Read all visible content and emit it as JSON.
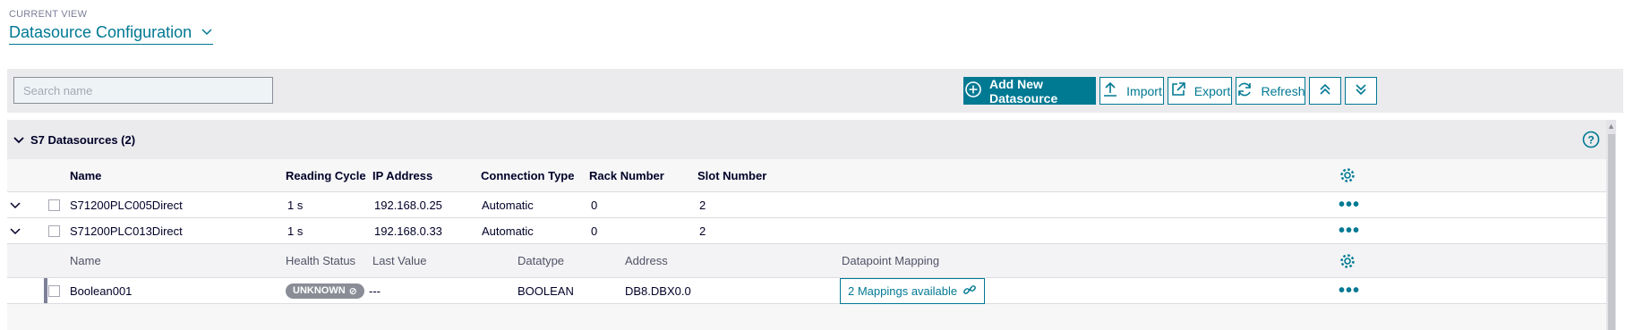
{
  "view": {
    "caption": "CURRENT VIEW",
    "title": "Datasource Configuration"
  },
  "toolbar": {
    "search_placeholder": "Search name",
    "add_label": "Add New Datasource",
    "import_label": "Import",
    "export_label": "Export",
    "refresh_label": "Refresh"
  },
  "group": {
    "title": "S7 Datasources (2)"
  },
  "columns": {
    "name": "Name",
    "reading_cycle": "Reading Cycle",
    "ip": "IP Address",
    "connection": "Connection Type",
    "rack": "Rack Number",
    "slot": "Slot Number"
  },
  "datasources": [
    {
      "name": "S71200PLC005Direct",
      "reading_cycle": "1 s",
      "ip": "192.168.0.25",
      "connection": "Automatic",
      "rack": "0",
      "slot": "2"
    },
    {
      "name": "S71200PLC013Direct",
      "reading_cycle": "1 s",
      "ip": "192.168.0.33",
      "connection": "Automatic",
      "rack": "0",
      "slot": "2"
    }
  ],
  "sub_columns": {
    "name": "Name",
    "health": "Health Status",
    "last_value": "Last Value",
    "datatype": "Datatype",
    "address": "Address",
    "mapping": "Datapoint Mapping"
  },
  "datapoints": [
    {
      "name": "Boolean001",
      "health": "UNKNOWN",
      "last_value": "---",
      "datatype": "BOOLEAN",
      "address": "DB8.DBX0.0",
      "mapping": "2 Mappings available"
    }
  ],
  "colors": {
    "accent": "#007993",
    "badge": "#8a8d96"
  }
}
